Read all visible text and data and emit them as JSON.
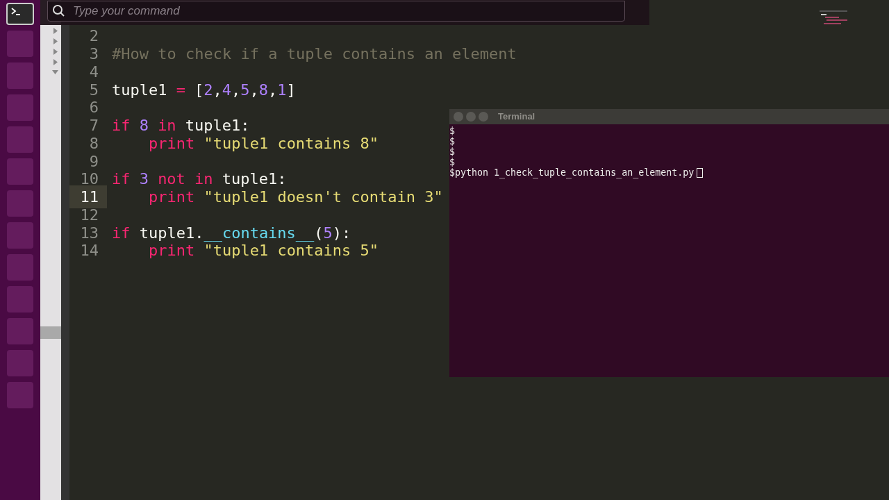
{
  "command_bar": {
    "placeholder": "Type your command"
  },
  "editor": {
    "lines": [
      {
        "number": "2",
        "selected": false
      },
      {
        "number": "3",
        "selected": false,
        "tokens": [
          {
            "text": "#How to check if a tuple contains an element",
            "kind": "comment"
          }
        ]
      },
      {
        "number": "4",
        "selected": false
      },
      {
        "number": "5",
        "selected": false,
        "tokens": [
          {
            "text": "tuple1",
            "kind": "plain"
          },
          {
            "text": "=",
            "kind": "operator",
            "gap": true
          },
          {
            "text": "[",
            "kind": "plain",
            "gap": true
          },
          {
            "text": "2",
            "kind": "number"
          },
          {
            "text": ",",
            "kind": "plain"
          },
          {
            "text": "4",
            "kind": "number"
          },
          {
            "text": ",",
            "kind": "plain"
          },
          {
            "text": "5",
            "kind": "number"
          },
          {
            "text": ",",
            "kind": "plain"
          },
          {
            "text": "8",
            "kind": "number"
          },
          {
            "text": ",",
            "kind": "plain"
          },
          {
            "text": "1",
            "kind": "number"
          },
          {
            "text": "]",
            "kind": "plain"
          }
        ]
      },
      {
        "number": "6",
        "selected": false
      },
      {
        "number": "7",
        "selected": false,
        "tokens": [
          {
            "text": "if",
            "kind": "keyword"
          },
          {
            "text": "8",
            "kind": "number",
            "gap": true
          },
          {
            "text": "in",
            "kind": "keyword",
            "gap": true
          },
          {
            "text": "tuple1:",
            "kind": "plain",
            "gap": true
          }
        ]
      },
      {
        "number": "8",
        "selected": false,
        "indented": true,
        "tokens": [
          {
            "text": "print",
            "kind": "keyword"
          },
          {
            "text": "\"tuple1 contains 8\"",
            "kind": "string",
            "gap": true
          }
        ]
      },
      {
        "number": "9",
        "selected": false
      },
      {
        "number": "10",
        "selected": false,
        "tokens": [
          {
            "text": "if",
            "kind": "keyword"
          },
          {
            "text": "3",
            "kind": "number",
            "gap": true
          },
          {
            "text": "not",
            "kind": "keyword",
            "gap": true
          },
          {
            "text": "in",
            "kind": "keyword",
            "gap": true
          },
          {
            "text": "tuple1:",
            "kind": "plain",
            "gap": true
          }
        ]
      },
      {
        "number": "11",
        "selected": true,
        "indented": true,
        "tokens": [
          {
            "text": "print",
            "kind": "keyword"
          },
          {
            "text": "\"tuple1 doesn't contain 3\"",
            "kind": "string",
            "gap": true
          }
        ]
      },
      {
        "number": "12",
        "selected": false
      },
      {
        "number": "13",
        "selected": false,
        "tokens": [
          {
            "text": "if",
            "kind": "keyword"
          },
          {
            "text": "tuple1.",
            "kind": "plain",
            "gap": true
          },
          {
            "text": "__contains__",
            "kind": "function"
          },
          {
            "text": "(",
            "kind": "plain"
          },
          {
            "text": "5",
            "kind": "number"
          },
          {
            "text": "):",
            "kind": "plain"
          }
        ]
      },
      {
        "number": "14",
        "selected": false,
        "indented": true,
        "tokens": [
          {
            "text": "print",
            "kind": "keyword"
          },
          {
            "text": "\"tuple1 contains 5\"",
            "kind": "string",
            "gap": true
          }
        ]
      }
    ]
  },
  "terminal": {
    "title": "Terminal",
    "lines": [
      "$",
      "$",
      "$",
      "$",
      "$python 1_check_tuple_contains_an_element.py"
    ]
  }
}
